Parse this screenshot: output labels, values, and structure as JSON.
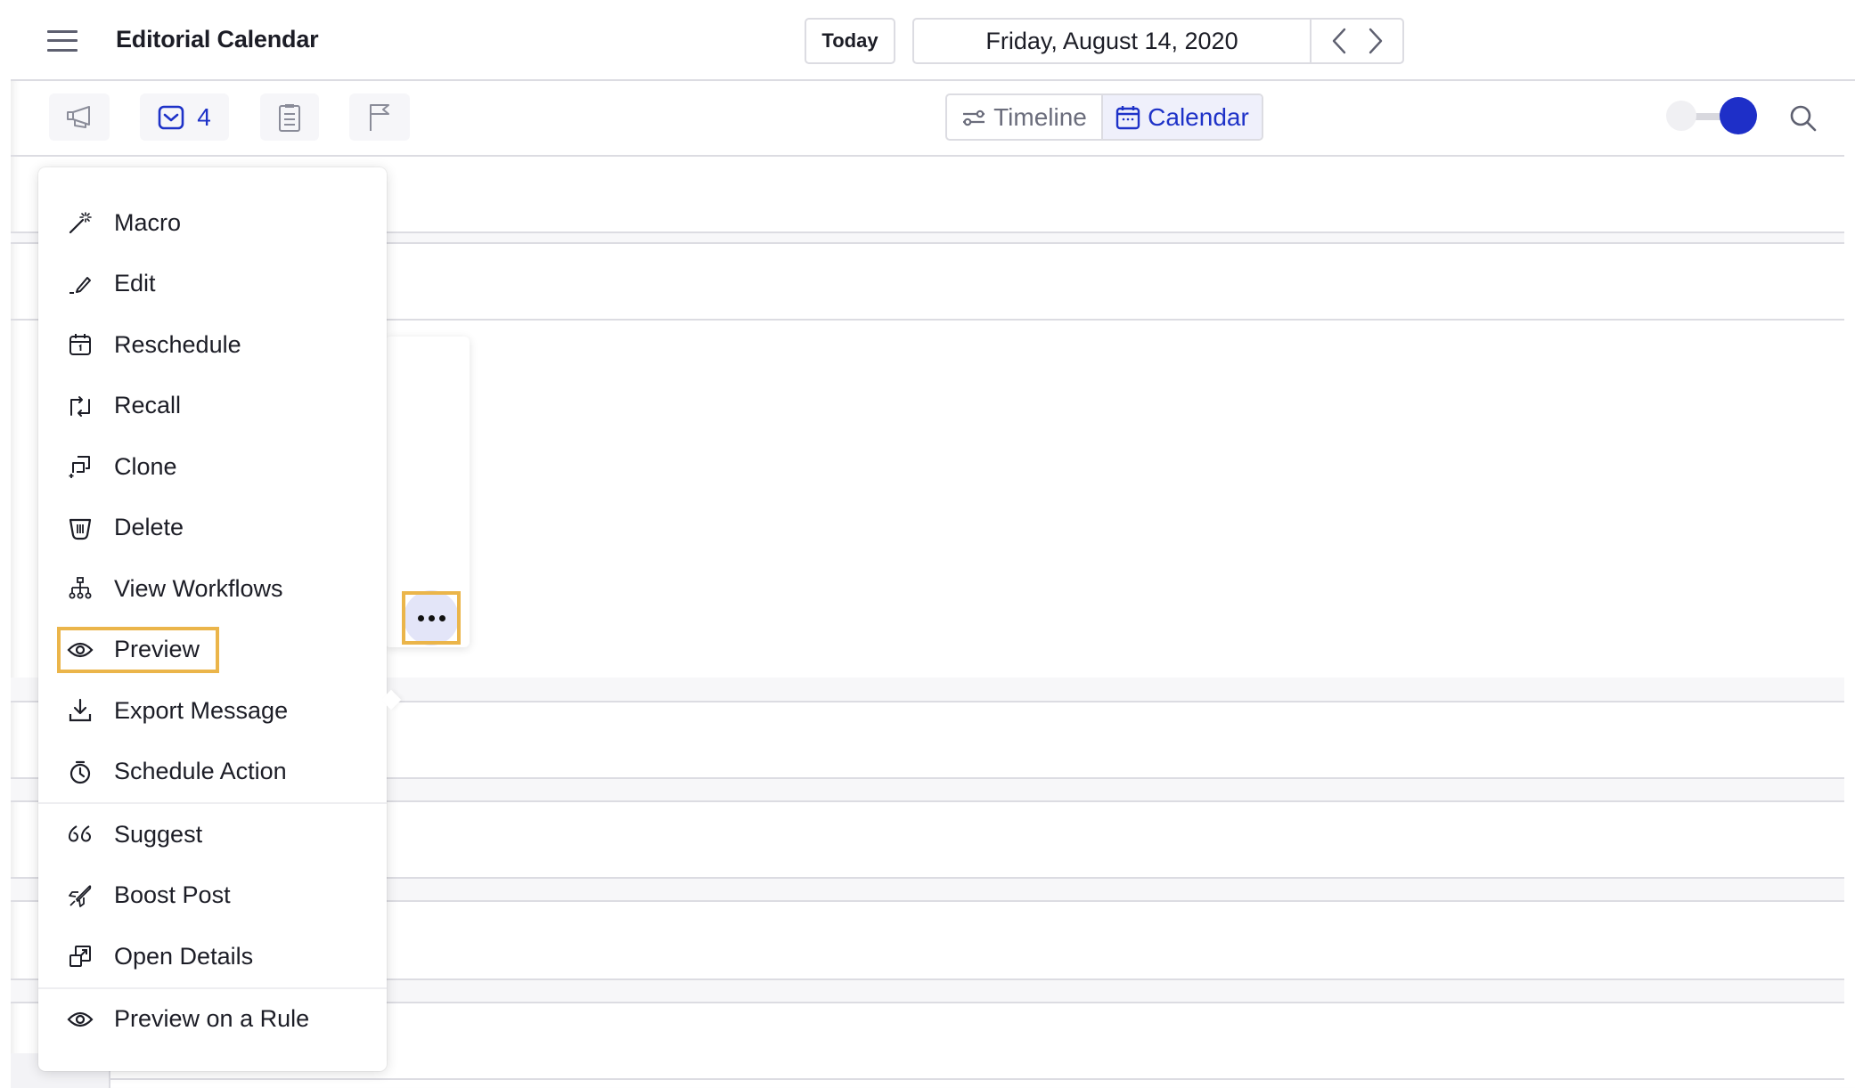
{
  "header": {
    "title": "Editorial Calendar",
    "today_label": "Today",
    "date_label": "Friday, August 14, 2020",
    "prev_label": "Previous day",
    "next_label": "Next day"
  },
  "toolbar": {
    "buttons": [
      {
        "name": "campaign",
        "icon": "megaphone-icon"
      },
      {
        "name": "messages",
        "icon": "mail-icon",
        "count": "4"
      },
      {
        "name": "notes",
        "icon": "clipboard-icon"
      },
      {
        "name": "flags",
        "icon": "flag-icon"
      }
    ],
    "views": [
      {
        "label": "Timeline",
        "icon": "sliders-icon",
        "active": false
      },
      {
        "label": "Calendar",
        "icon": "calendar-icon",
        "active": true
      }
    ],
    "toggle_on": true,
    "search_icon": "search-icon"
  },
  "colors": {
    "accent": "#1e32c8",
    "highlight": "#ebb54a",
    "border": "#dcdce2",
    "band": "#f7f7f9",
    "more_button_bg": "#e3e5f8"
  },
  "context_menu": {
    "groups": [
      [
        {
          "label": "Macro",
          "icon": "magic-wand-icon"
        },
        {
          "label": "Edit",
          "icon": "pencil-icon"
        },
        {
          "label": "Reschedule",
          "icon": "calendar-day-icon"
        },
        {
          "label": "Recall",
          "icon": "recall-arrows-icon"
        },
        {
          "label": "Clone",
          "icon": "clone-icon"
        },
        {
          "label": "Delete",
          "icon": "trash-icon"
        },
        {
          "label": "View Workflows",
          "icon": "workflow-icon"
        },
        {
          "label": "Preview",
          "icon": "eye-icon",
          "highlighted": true
        },
        {
          "label": "Export Message",
          "icon": "download-icon"
        },
        {
          "label": "Schedule Action",
          "icon": "stopwatch-icon"
        }
      ],
      [
        {
          "label": "Suggest",
          "icon": "quote-icon"
        },
        {
          "label": "Boost Post",
          "icon": "rocket-icon"
        },
        {
          "label": "Open Details",
          "icon": "open-external-icon"
        }
      ],
      [
        {
          "label": "Preview on a Rule",
          "icon": "eye-icon"
        }
      ]
    ]
  },
  "more_button": {
    "label": "More options",
    "highlighted": true
  }
}
